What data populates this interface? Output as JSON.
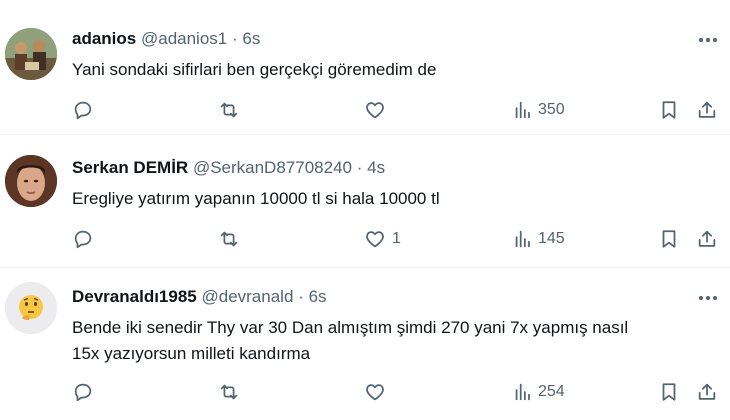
{
  "posts": [
    {
      "name": "adanios",
      "handle": "@adanios1",
      "dot": "·",
      "time": "6s",
      "text": "Yani sondaki sifirlari ben gerçekçi göremedim de",
      "likes": "",
      "views": "350",
      "avatar": "avatar-group-photo"
    },
    {
      "name": "Serkan DEMİR",
      "handle": "@SerkanD87708240",
      "dot": "·",
      "time": "4s",
      "text": "Eregliye  yatırım yapanın 10000 tl si hala 10000 tl",
      "likes": "1",
      "views": "145",
      "avatar": "avatar-man-portrait"
    },
    {
      "name": "Devranaldı1985",
      "handle": "@devranald",
      "dot": "·",
      "time": "6s",
      "text_line1": "Bende iki senedir Thy var 30 Dan almıştım şimdi 270 yani 7x yapmış nasıl",
      "text_line2": "15x yazıyorsun milleti kandırma",
      "likes": "",
      "views": "254",
      "avatar": "thinking-face-emoji"
    }
  ],
  "colors": {
    "text": "#0f1419",
    "secondary": "#536471",
    "divider": "#eff3f4"
  }
}
